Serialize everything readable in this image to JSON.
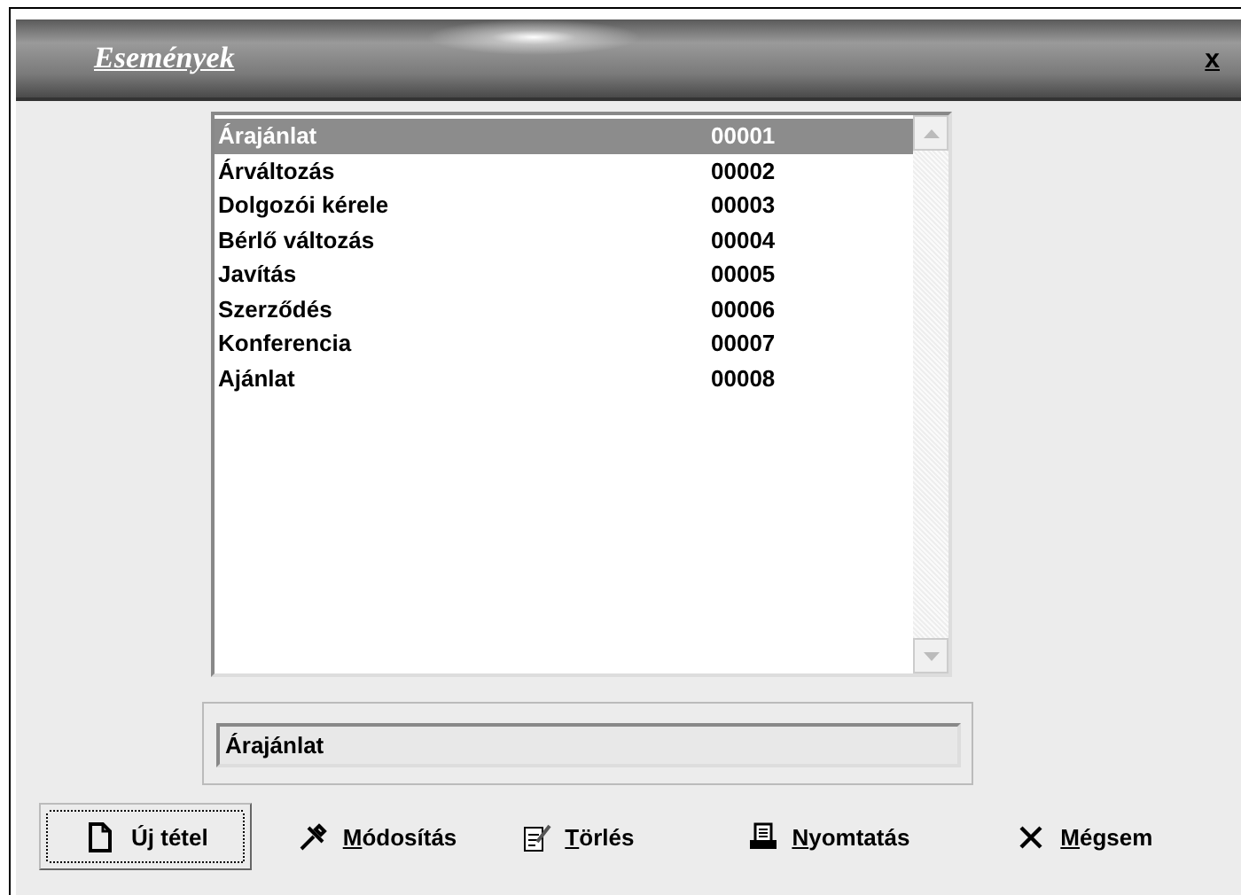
{
  "window": {
    "title": "Események",
    "close": "x"
  },
  "list": {
    "rows": [
      {
        "name": "Árajánlat",
        "code": "00001",
        "selected": true
      },
      {
        "name": "Árváltozás",
        "code": "00002",
        "selected": false
      },
      {
        "name": "Dolgozói kérele",
        "code": "00003",
        "selected": false
      },
      {
        "name": "Bérlő változás",
        "code": "00004",
        "selected": false
      },
      {
        "name": "Javítás",
        "code": "00005",
        "selected": false
      },
      {
        "name": "Szerződés",
        "code": "00006",
        "selected": false
      },
      {
        "name": "Konferencia",
        "code": "00007",
        "selected": false
      },
      {
        "name": "Ajánlat",
        "code": "00008",
        "selected": false
      }
    ]
  },
  "field": {
    "value": "Árajánlat"
  },
  "buttons": [
    {
      "kind": "new",
      "before": "Ú",
      "key": "j",
      "after": " tétel",
      "focused": true
    },
    {
      "kind": "edit",
      "key": "M",
      "after": "ódosítás",
      "focused": false
    },
    {
      "kind": "delete",
      "key": "T",
      "after": "örlés",
      "focused": false
    },
    {
      "kind": "print",
      "key": "N",
      "after": "yomtatás",
      "focused": false
    },
    {
      "kind": "cancel",
      "key": "M",
      "after": "égsem",
      "focused": false
    }
  ]
}
